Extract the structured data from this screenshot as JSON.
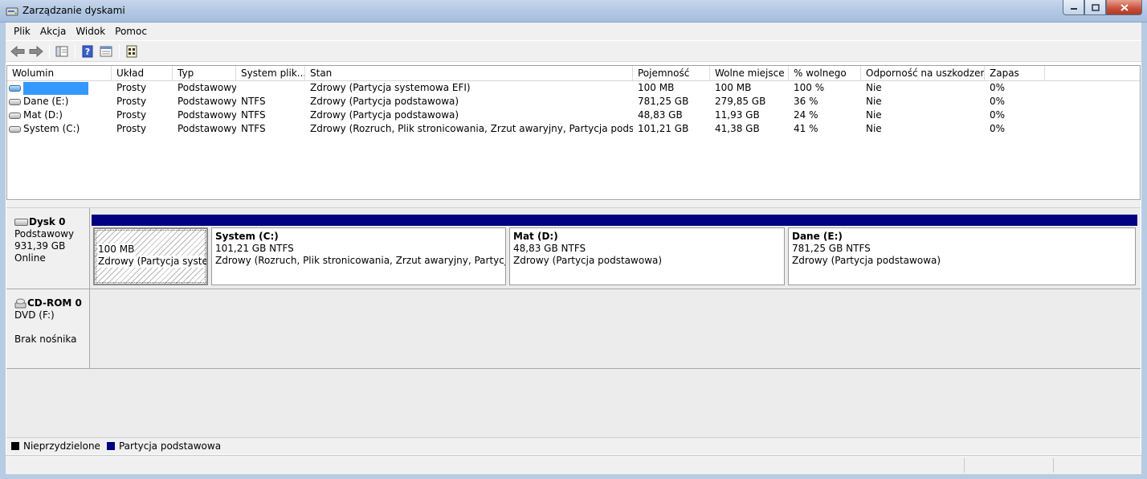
{
  "window": {
    "title": "Zarządzanie dyskami"
  },
  "menu": [
    "Plik",
    "Akcja",
    "Widok",
    "Pomoc"
  ],
  "toolbar": {
    "icons": [
      "back-arrow-icon",
      "forward-arrow-icon",
      "show-hide-tree-icon",
      "help-icon",
      "properties-icon",
      "disk-settings-icon"
    ]
  },
  "volume_list": {
    "columns": [
      "Wolumin",
      "Układ",
      "Typ",
      "System plik...",
      "Stan",
      "Pojemność",
      "Wolne miejsce",
      "% wolnego",
      "Odporność na uszkodzenia",
      "Zapas"
    ],
    "rows": [
      {
        "name": "",
        "layout": "Prosty",
        "type": "Podstawowy",
        "fs": "",
        "status": "Zdrowy (Partycja systemowa EFI)",
        "capacity": "100 MB",
        "free": "100 MB",
        "pct_free": "100 %",
        "fault": "Nie",
        "overhead": "0%"
      },
      {
        "name": "Dane (E:)",
        "layout": "Prosty",
        "type": "Podstawowy",
        "fs": "NTFS",
        "status": "Zdrowy (Partycja podstawowa)",
        "capacity": "781,25 GB",
        "free": "279,85 GB",
        "pct_free": "36 %",
        "fault": "Nie",
        "overhead": "0%"
      },
      {
        "name": "Mat (D:)",
        "layout": "Prosty",
        "type": "Podstawowy",
        "fs": "NTFS",
        "status": "Zdrowy (Partycja podstawowa)",
        "capacity": "48,83 GB",
        "free": "11,93 GB",
        "pct_free": "24 %",
        "fault": "Nie",
        "overhead": "0%"
      },
      {
        "name": "System (C:)",
        "layout": "Prosty",
        "type": "Podstawowy",
        "fs": "NTFS",
        "status": "Zdrowy (Rozruch, Plik stronicowania, Zrzut awaryjny, Partycja podstawowa)",
        "capacity": "101,21 GB",
        "free": "41,38 GB",
        "pct_free": "41 %",
        "fault": "Nie",
        "overhead": "0%"
      }
    ]
  },
  "disks": {
    "disk0": {
      "name": "Dysk 0",
      "kind": "Podstawowy",
      "size": "931,39 GB",
      "state": "Online",
      "partitions": [
        {
          "name": "",
          "size": "100 MB",
          "status": "Zdrowy (Partycja systemo"
        },
        {
          "name": "System  (C:)",
          "size": "101,21 GB NTFS",
          "status": "Zdrowy (Rozruch, Plik stronicowania, Zrzut awaryjny, Partycja podst"
        },
        {
          "name": "Mat  (D:)",
          "size": "48,83 GB NTFS",
          "status": "Zdrowy (Partycja podstawowa)"
        },
        {
          "name": "Dane  (E:)",
          "size": "781,25 GB NTFS",
          "status": "Zdrowy (Partycja podstawowa)"
        }
      ]
    },
    "cdrom0": {
      "name": "CD-ROM 0",
      "kind": "DVD (F:)",
      "media": "Brak nośnika"
    }
  },
  "legend": [
    {
      "label": "Nieprzydzielone",
      "color": "#000000"
    },
    {
      "label": "Partycja podstawowa",
      "color": "#000080"
    }
  ],
  "colors": {
    "partition_bar": "#000080",
    "selection": "#3399ff"
  }
}
